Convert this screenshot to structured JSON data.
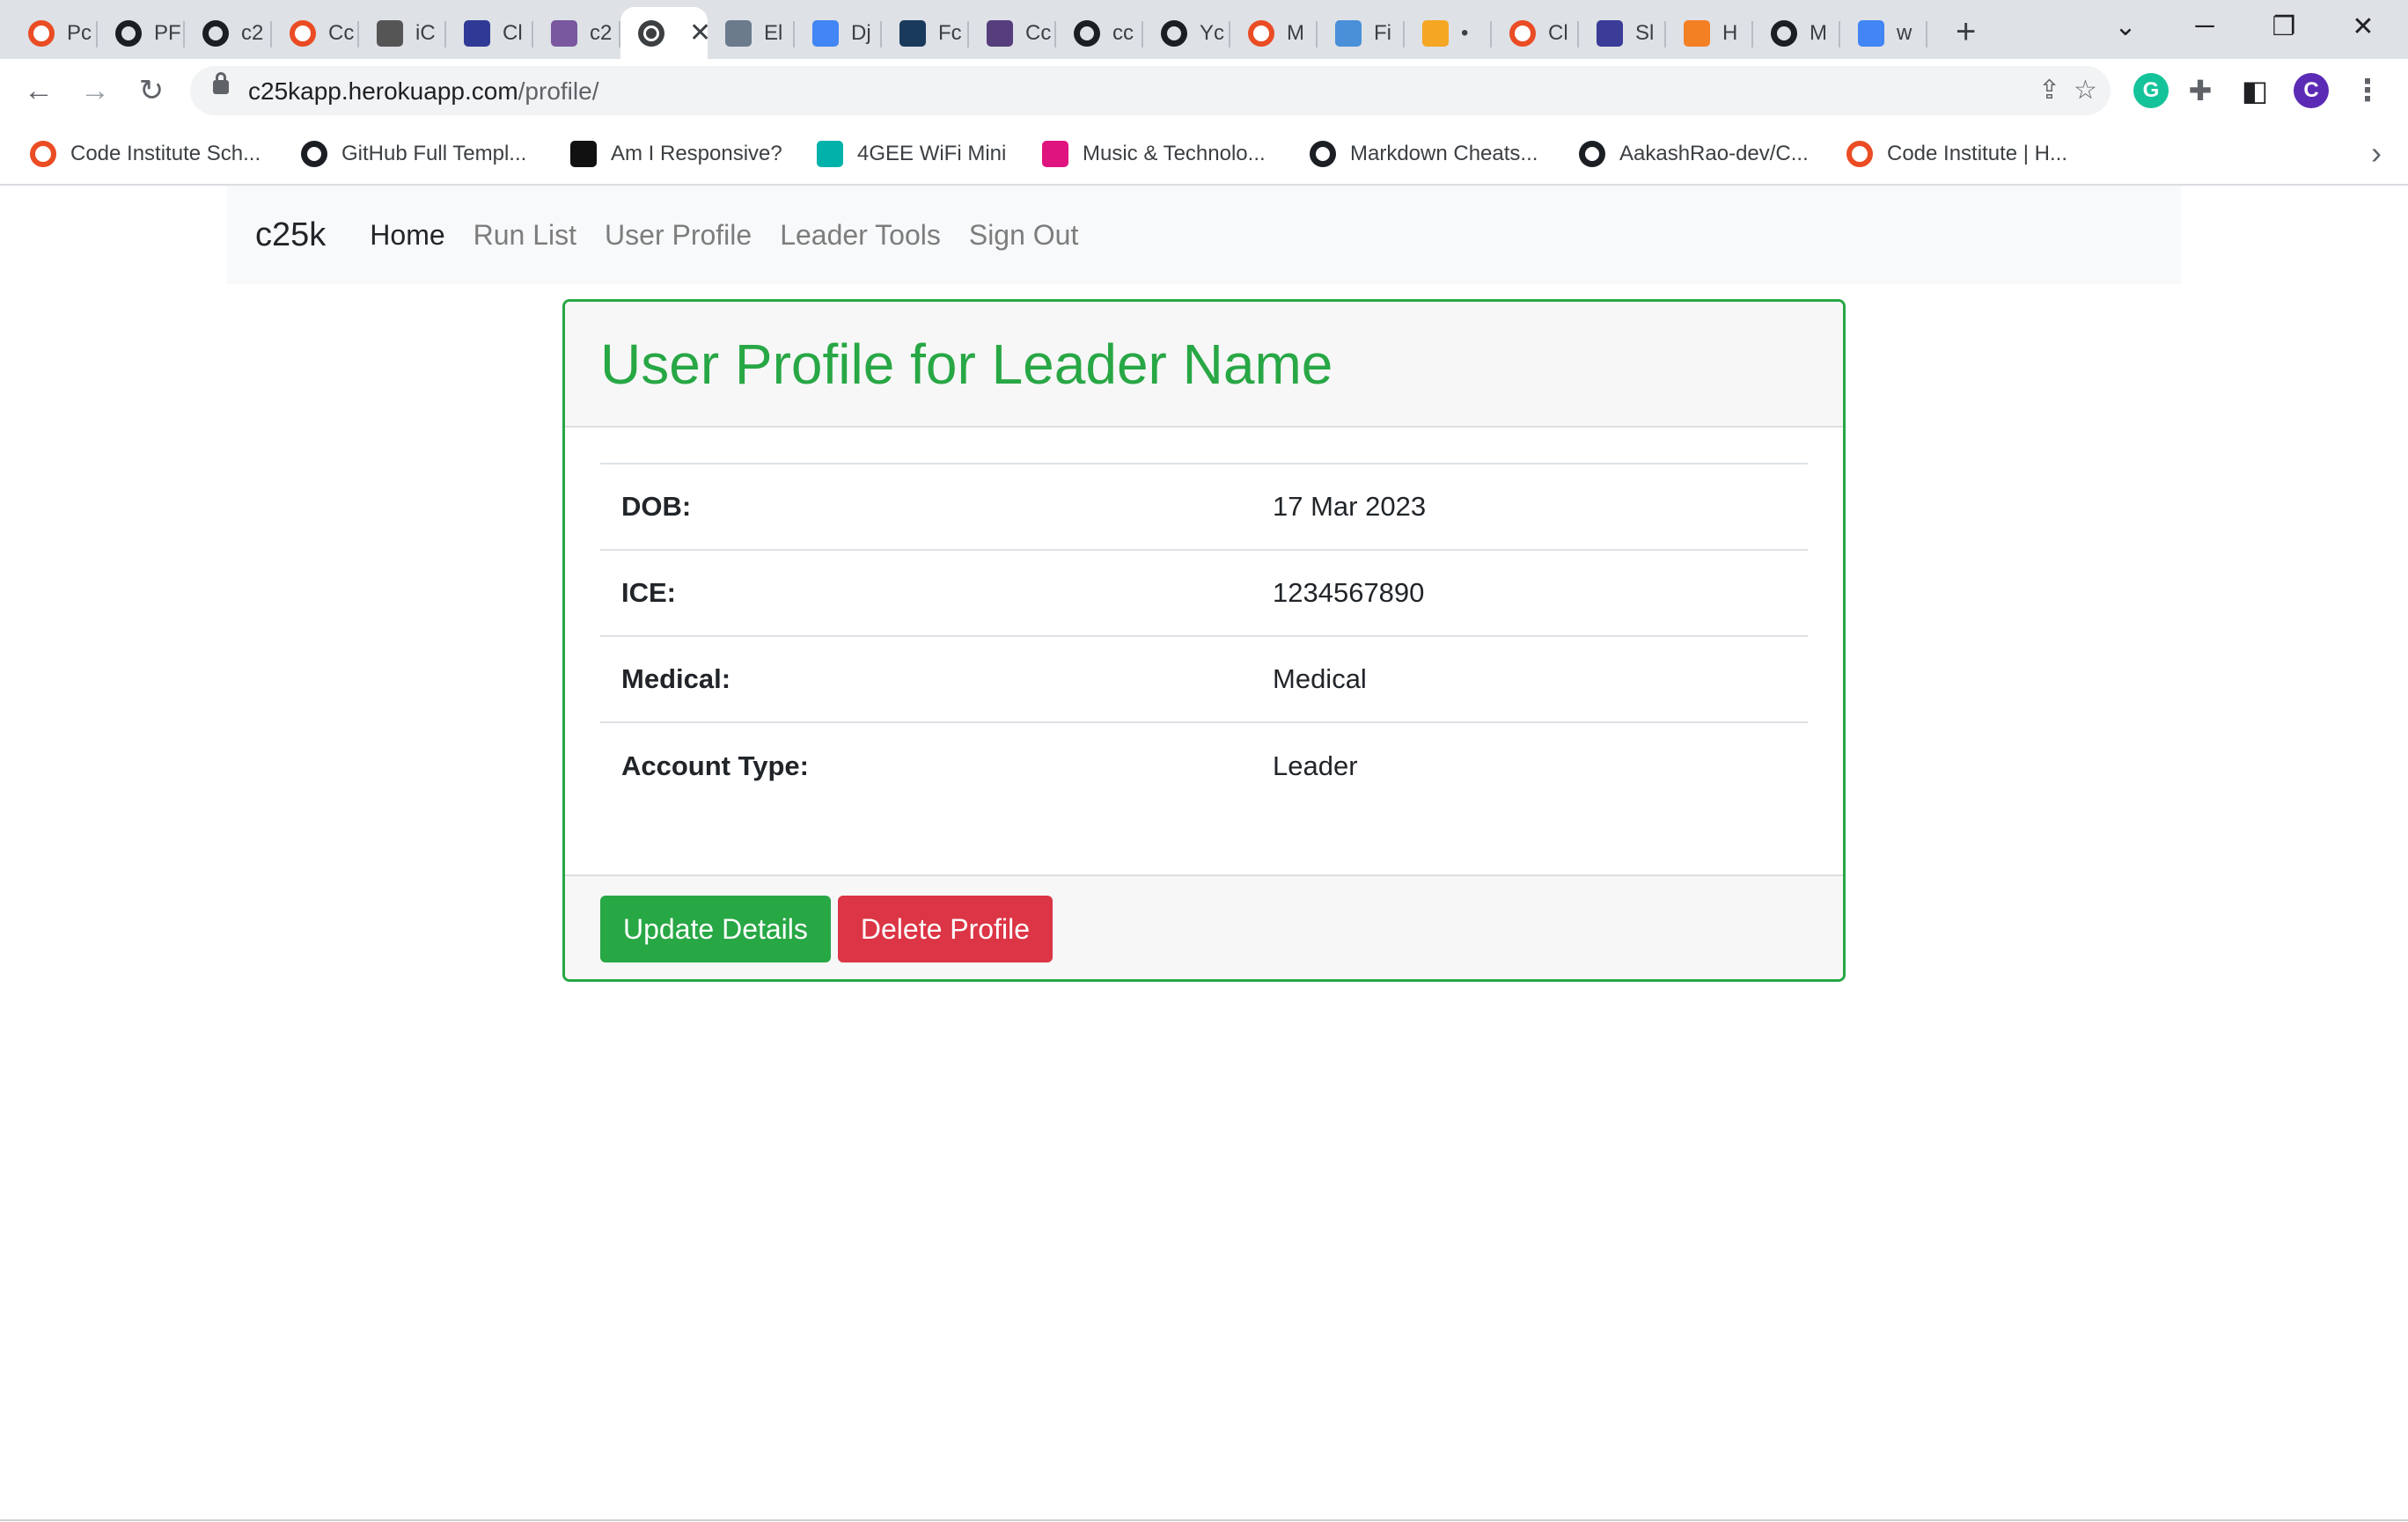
{
  "browser": {
    "tabs": [
      {
        "title": "Pc",
        "icon": "code-institute-icon",
        "color": "#ea4c24"
      },
      {
        "title": "PF",
        "icon": "github-icon",
        "color": "#1b1f23"
      },
      {
        "title": "c2",
        "icon": "github-icon",
        "color": "#1b1f23"
      },
      {
        "title": "Cc",
        "icon": "code-institute-icon",
        "color": "#ea4c24"
      },
      {
        "title": "iC",
        "icon": "apple-icon",
        "color": "#555555"
      },
      {
        "title": "Cl",
        "icon": "dashboard-icon",
        "color": "#2f3a96"
      },
      {
        "title": "c2",
        "icon": "heroku-icon",
        "color": "#79589f"
      },
      {
        "title": "",
        "icon": "globe-icon",
        "color": "#3c4043",
        "active": true
      },
      {
        "title": "El",
        "icon": "elephant-icon",
        "color": "#6b7b8c"
      },
      {
        "title": "Dj",
        "icon": "docs-icon",
        "color": "#4285f4"
      },
      {
        "title": "Fc",
        "icon": "fc-icon",
        "color": "#1a3a5c"
      },
      {
        "title": "Cc",
        "icon": "bootstrap-icon",
        "color": "#563d7c"
      },
      {
        "title": "cc",
        "icon": "github-icon",
        "color": "#1b1f23"
      },
      {
        "title": "Yc",
        "icon": "github-icon",
        "color": "#1b1f23"
      },
      {
        "title": "M",
        "icon": "code-institute-icon",
        "color": "#ea4c24"
      },
      {
        "title": "Fi",
        "icon": "flag-icon",
        "color": "#4a90d9"
      },
      {
        "title": "•",
        "icon": "grammarly-g-icon",
        "color": "#f5a623"
      },
      {
        "title": "Cl",
        "icon": "code-institute-icon",
        "color": "#ea4c24"
      },
      {
        "title": "Sl",
        "icon": "shield-icon",
        "color": "#3b3b98"
      },
      {
        "title": "H",
        "icon": "stackoverflow-icon",
        "color": "#f48024"
      },
      {
        "title": "M",
        "icon": "github-icon",
        "color": "#1b1f23"
      },
      {
        "title": "w",
        "icon": "google-icon",
        "color": "#4285f4"
      }
    ],
    "new_tab_label": "+",
    "url_host": "c25kapp.herokuapp.com",
    "url_path": "/profile/",
    "profile_initial": "C",
    "bookmarks": [
      {
        "label": "Code Institute Sch...",
        "icon": "code-institute-icon",
        "color": "#ea4c24"
      },
      {
        "label": "GitHub Full Templ...",
        "icon": "github-icon",
        "color": "#1b1f23"
      },
      {
        "label": "Am I Responsive?",
        "icon": "ui-logo-icon",
        "color": "#111111"
      },
      {
        "label": "4GEE WiFi Mini",
        "icon": "ee-icon",
        "color": "#00b2a9"
      },
      {
        "label": "Music & Technolo...",
        "icon": "music-icon",
        "color": "#e0147f"
      },
      {
        "label": "Markdown Cheats...",
        "icon": "github-icon",
        "color": "#1b1f23"
      },
      {
        "label": "AakashRao-dev/C...",
        "icon": "github-icon",
        "color": "#1b1f23"
      },
      {
        "label": "Code Institute | H...",
        "icon": "code-institute-icon",
        "color": "#ea4c24"
      }
    ]
  },
  "site": {
    "brand": "c25k",
    "nav": [
      {
        "label": "Home",
        "active": true
      },
      {
        "label": "Run List",
        "active": false
      },
      {
        "label": "User Profile",
        "active": false
      },
      {
        "label": "Leader Tools",
        "active": false
      },
      {
        "label": "Sign Out",
        "active": false
      }
    ]
  },
  "profile": {
    "title": "User Profile for Leader Name",
    "rows": [
      {
        "label": "DOB:",
        "value": "17 Mar 2023"
      },
      {
        "label": "ICE:",
        "value": "1234567890"
      },
      {
        "label": "Medical:",
        "value": "Medical"
      },
      {
        "label": "Account Type:",
        "value": "Leader"
      }
    ],
    "update_button": "Update Details",
    "delete_button": "Delete Profile"
  },
  "colors": {
    "success": "#28a745",
    "danger": "#dc3545",
    "profile_avatar": "#5b2bb5",
    "grammarly": "#15c39a"
  }
}
